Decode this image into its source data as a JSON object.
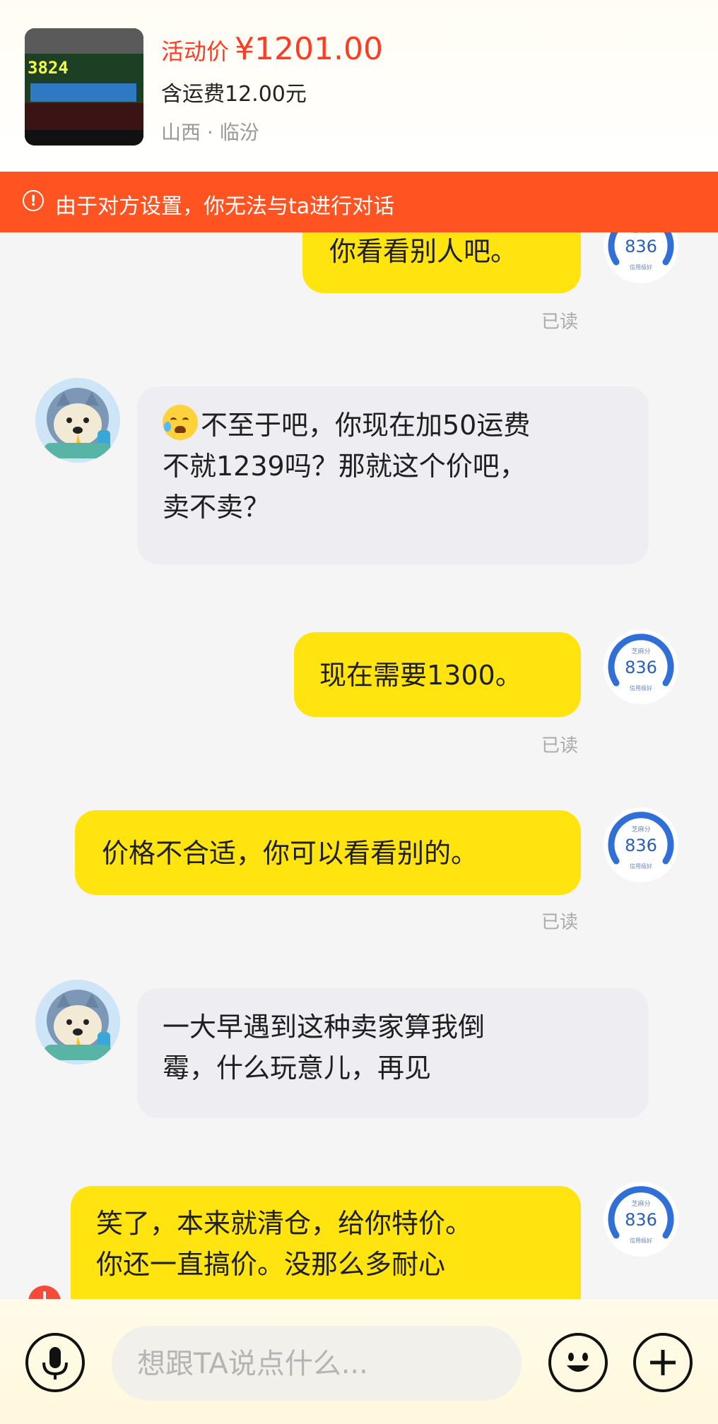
{
  "product": {
    "price_label": "活动价",
    "price_value": "¥1201.00",
    "shipping": "含运费12.00元",
    "location": "山西 · 临汾",
    "thumbnail_digits": "3824"
  },
  "notice": {
    "icon": "exclamation-circle-icon",
    "text": "由于对方设置，你无法与ta进行对话"
  },
  "credit_badge": {
    "title": "芝麻分",
    "score": "836",
    "subtitle": "信用极好"
  },
  "messages": [
    {
      "from": "me",
      "lines": [
        "你看看别人吧。"
      ],
      "status": "已读"
    },
    {
      "from": "other",
      "emoji": "crying-laughing-emoji",
      "lines": [
        "不至于吧，你现在加50运费",
        "不就1239吗？那就这个价吧，",
        "卖不卖？"
      ]
    },
    {
      "from": "me",
      "lines": [
        "现在需要1300。"
      ],
      "status": "已读"
    },
    {
      "from": "me",
      "lines": [
        "价格不合适，你可以看看别的。"
      ],
      "status": "已读"
    },
    {
      "from": "other",
      "lines": [
        "一大早遇到这种卖家算我倒",
        "霉，什么玩意儿，再见"
      ]
    },
    {
      "from": "me",
      "lines": [
        "笑了，本来就清仓，给你特价。",
        "你还一直搞价。没那么多耐心"
      ]
    }
  ],
  "input": {
    "placeholder": "想跟TA说点什么..."
  },
  "buttons": {
    "voice": "microphone-icon",
    "emoji": "smiley-icon",
    "more": "plus-icon"
  },
  "colors": {
    "accent_red": "#ff3b22",
    "notice_orange": "#ff5422",
    "my_bubble": "#ffe40f",
    "their_bubble": "#ededf2",
    "badge_blue": "#2f6fd6"
  }
}
